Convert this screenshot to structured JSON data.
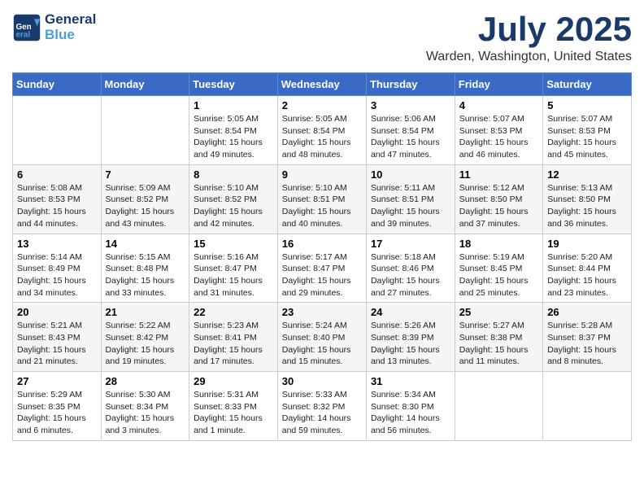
{
  "header": {
    "logo_line1": "General",
    "logo_line2": "Blue",
    "month_title": "July 2025",
    "location": "Warden, Washington, United States"
  },
  "weekdays": [
    "Sunday",
    "Monday",
    "Tuesday",
    "Wednesday",
    "Thursday",
    "Friday",
    "Saturday"
  ],
  "weeks": [
    [
      {
        "day": "",
        "info": ""
      },
      {
        "day": "",
        "info": ""
      },
      {
        "day": "1",
        "info": "Sunrise: 5:05 AM\nSunset: 8:54 PM\nDaylight: 15 hours and 49 minutes."
      },
      {
        "day": "2",
        "info": "Sunrise: 5:05 AM\nSunset: 8:54 PM\nDaylight: 15 hours and 48 minutes."
      },
      {
        "day": "3",
        "info": "Sunrise: 5:06 AM\nSunset: 8:54 PM\nDaylight: 15 hours and 47 minutes."
      },
      {
        "day": "4",
        "info": "Sunrise: 5:07 AM\nSunset: 8:53 PM\nDaylight: 15 hours and 46 minutes."
      },
      {
        "day": "5",
        "info": "Sunrise: 5:07 AM\nSunset: 8:53 PM\nDaylight: 15 hours and 45 minutes."
      }
    ],
    [
      {
        "day": "6",
        "info": "Sunrise: 5:08 AM\nSunset: 8:53 PM\nDaylight: 15 hours and 44 minutes."
      },
      {
        "day": "7",
        "info": "Sunrise: 5:09 AM\nSunset: 8:52 PM\nDaylight: 15 hours and 43 minutes."
      },
      {
        "day": "8",
        "info": "Sunrise: 5:10 AM\nSunset: 8:52 PM\nDaylight: 15 hours and 42 minutes."
      },
      {
        "day": "9",
        "info": "Sunrise: 5:10 AM\nSunset: 8:51 PM\nDaylight: 15 hours and 40 minutes."
      },
      {
        "day": "10",
        "info": "Sunrise: 5:11 AM\nSunset: 8:51 PM\nDaylight: 15 hours and 39 minutes."
      },
      {
        "day": "11",
        "info": "Sunrise: 5:12 AM\nSunset: 8:50 PM\nDaylight: 15 hours and 37 minutes."
      },
      {
        "day": "12",
        "info": "Sunrise: 5:13 AM\nSunset: 8:50 PM\nDaylight: 15 hours and 36 minutes."
      }
    ],
    [
      {
        "day": "13",
        "info": "Sunrise: 5:14 AM\nSunset: 8:49 PM\nDaylight: 15 hours and 34 minutes."
      },
      {
        "day": "14",
        "info": "Sunrise: 5:15 AM\nSunset: 8:48 PM\nDaylight: 15 hours and 33 minutes."
      },
      {
        "day": "15",
        "info": "Sunrise: 5:16 AM\nSunset: 8:47 PM\nDaylight: 15 hours and 31 minutes."
      },
      {
        "day": "16",
        "info": "Sunrise: 5:17 AM\nSunset: 8:47 PM\nDaylight: 15 hours and 29 minutes."
      },
      {
        "day": "17",
        "info": "Sunrise: 5:18 AM\nSunset: 8:46 PM\nDaylight: 15 hours and 27 minutes."
      },
      {
        "day": "18",
        "info": "Sunrise: 5:19 AM\nSunset: 8:45 PM\nDaylight: 15 hours and 25 minutes."
      },
      {
        "day": "19",
        "info": "Sunrise: 5:20 AM\nSunset: 8:44 PM\nDaylight: 15 hours and 23 minutes."
      }
    ],
    [
      {
        "day": "20",
        "info": "Sunrise: 5:21 AM\nSunset: 8:43 PM\nDaylight: 15 hours and 21 minutes."
      },
      {
        "day": "21",
        "info": "Sunrise: 5:22 AM\nSunset: 8:42 PM\nDaylight: 15 hours and 19 minutes."
      },
      {
        "day": "22",
        "info": "Sunrise: 5:23 AM\nSunset: 8:41 PM\nDaylight: 15 hours and 17 minutes."
      },
      {
        "day": "23",
        "info": "Sunrise: 5:24 AM\nSunset: 8:40 PM\nDaylight: 15 hours and 15 minutes."
      },
      {
        "day": "24",
        "info": "Sunrise: 5:26 AM\nSunset: 8:39 PM\nDaylight: 15 hours and 13 minutes."
      },
      {
        "day": "25",
        "info": "Sunrise: 5:27 AM\nSunset: 8:38 PM\nDaylight: 15 hours and 11 minutes."
      },
      {
        "day": "26",
        "info": "Sunrise: 5:28 AM\nSunset: 8:37 PM\nDaylight: 15 hours and 8 minutes."
      }
    ],
    [
      {
        "day": "27",
        "info": "Sunrise: 5:29 AM\nSunset: 8:35 PM\nDaylight: 15 hours and 6 minutes."
      },
      {
        "day": "28",
        "info": "Sunrise: 5:30 AM\nSunset: 8:34 PM\nDaylight: 15 hours and 3 minutes."
      },
      {
        "day": "29",
        "info": "Sunrise: 5:31 AM\nSunset: 8:33 PM\nDaylight: 15 hours and 1 minute."
      },
      {
        "day": "30",
        "info": "Sunrise: 5:33 AM\nSunset: 8:32 PM\nDaylight: 14 hours and 59 minutes."
      },
      {
        "day": "31",
        "info": "Sunrise: 5:34 AM\nSunset: 8:30 PM\nDaylight: 14 hours and 56 minutes."
      },
      {
        "day": "",
        "info": ""
      },
      {
        "day": "",
        "info": ""
      }
    ]
  ]
}
